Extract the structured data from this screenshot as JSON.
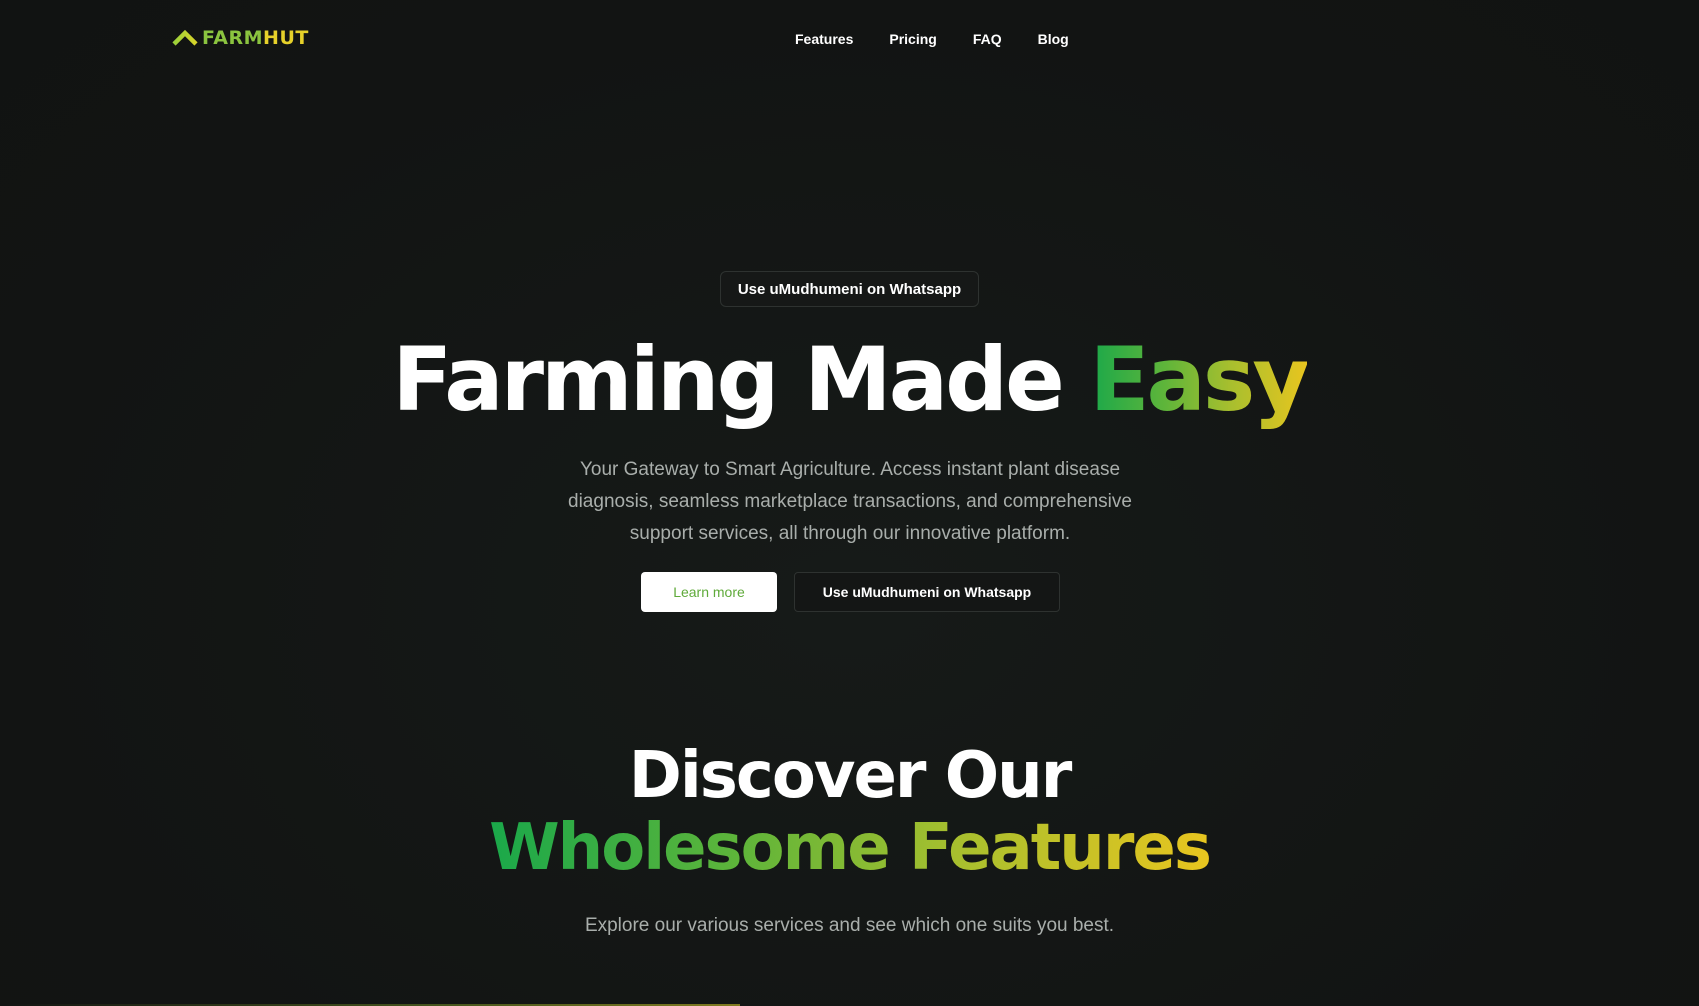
{
  "logo": {
    "part1": "FARM",
    "part2": "HUT",
    "icon": "chevron-up-icon"
  },
  "nav": {
    "items": [
      "Features",
      "Pricing",
      "FAQ",
      "Blog"
    ]
  },
  "hero": {
    "badge": "Use uMudhumeni on Whatsapp",
    "title_plain": "Farming Made ",
    "title_accent": "Easy",
    "subtitle": "Your Gateway to Smart Agriculture. Access instant plant disease diagnosis, seamless marketplace transactions, and comprehensive support services, all through our innovative platform.",
    "learn_more": "Learn more",
    "whatsapp_button": "Use uMudhumeni on Whatsapp"
  },
  "features": {
    "title_line1": "Discover Our",
    "title_line2": "Wholesome Features",
    "subtitle": "Explore our various services and see which one suits you best."
  },
  "colors": {
    "background": "#141615",
    "gradient_start": "#1aa84a",
    "gradient_end": "#e8c51f",
    "muted_text": "#a9aeab"
  }
}
